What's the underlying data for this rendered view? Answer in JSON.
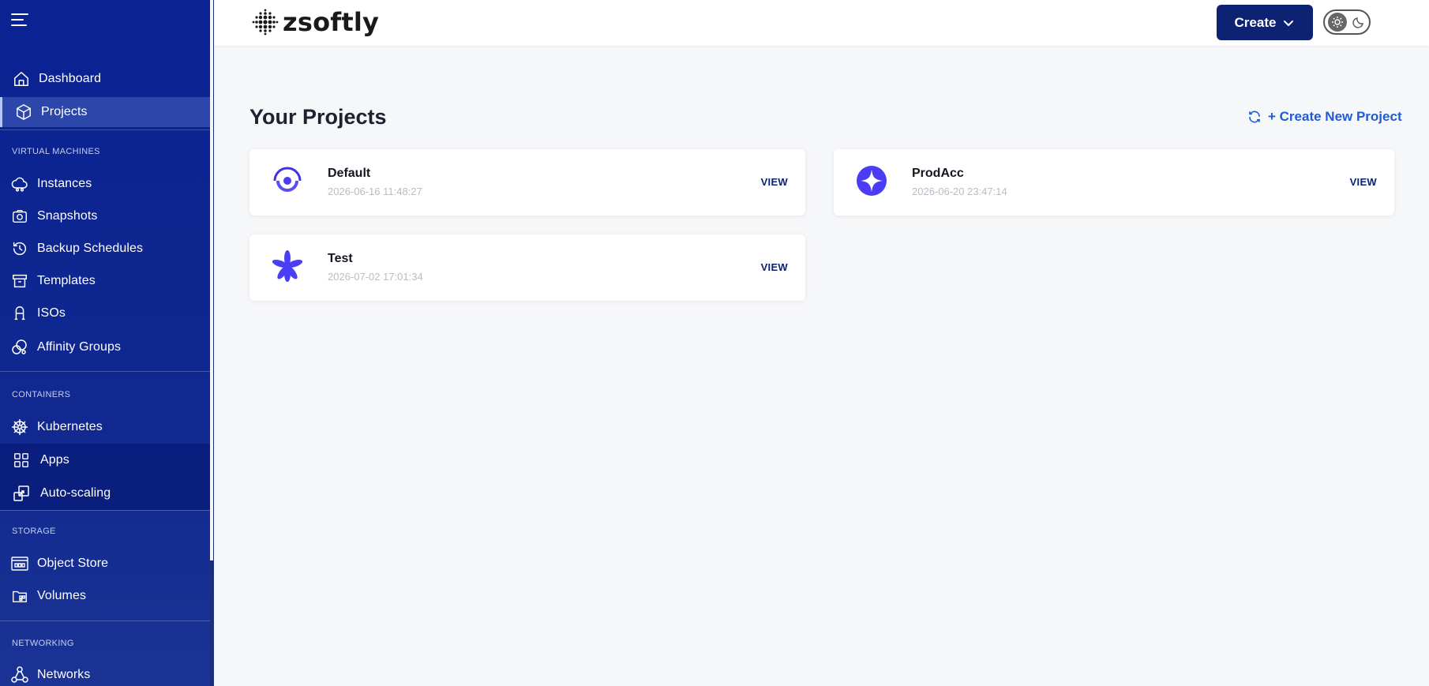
{
  "app": {
    "brand": "zsoftly"
  },
  "sidebar": {
    "items": [
      {
        "label": "Dashboard",
        "icon": "home-icon"
      },
      {
        "label": "Projects",
        "icon": "cube-icon"
      },
      {
        "label": "Instances",
        "icon": "cloud-instances-icon"
      },
      {
        "label": "Snapshots",
        "icon": "camera-icon"
      },
      {
        "label": "Backup Schedules",
        "icon": "history-icon"
      },
      {
        "label": "Templates",
        "icon": "archive-icon"
      },
      {
        "label": "ISOs",
        "icon": "iso-icon"
      },
      {
        "label": "Affinity Groups",
        "icon": "affinity-icon"
      },
      {
        "label": "Kubernetes",
        "icon": "kubernetes-icon"
      },
      {
        "label": "Apps",
        "icon": "apps-grid-icon"
      },
      {
        "label": "Auto-scaling",
        "icon": "autoscaling-icon"
      },
      {
        "label": "Object Store",
        "icon": "object-store-icon"
      },
      {
        "label": "Volumes",
        "icon": "volumes-icon"
      },
      {
        "label": "Networks",
        "icon": "network-icon"
      }
    ],
    "sections": {
      "virtual_machines": "VIRTUAL MACHINES",
      "containers": "CONTAINERS",
      "storage": "STORAGE",
      "networking": "NETWORKING"
    }
  },
  "header": {
    "create_label": "Create"
  },
  "main": {
    "title": "Your Projects",
    "create_new_label": "+ Create New Project",
    "projects": [
      {
        "name": "Default",
        "date": "2026-06-16 11:48:27",
        "view_label": "VIEW",
        "icon": "ring-eye-icon"
      },
      {
        "name": "ProdAcc",
        "date": "2026-06-20 23:47:14",
        "view_label": "VIEW",
        "icon": "sparkle-icon"
      },
      {
        "name": "Test",
        "date": "2026-07-02 17:01:34",
        "view_label": "VIEW",
        "icon": "asterisk-icon"
      }
    ]
  },
  "colors": {
    "sidebar": "#0a2292",
    "accent": "#1f5bd3",
    "button": "#0d2273",
    "project_icon": "#4b3df5"
  }
}
